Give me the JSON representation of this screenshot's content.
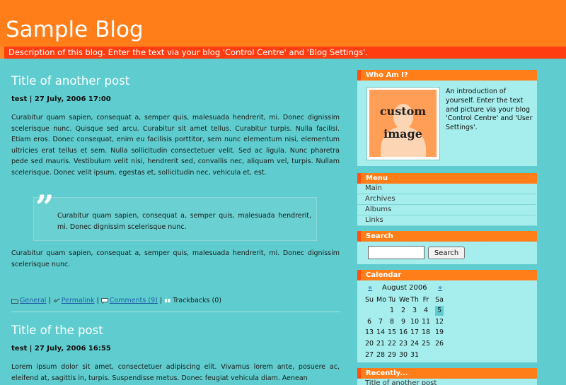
{
  "blog": {
    "title": "Sample Blog",
    "description": "Description of this blog. Enter the text via your blog 'Control Centre' and 'Blog Settings'."
  },
  "posts": [
    {
      "title": "Title of another post",
      "meta": "test | 27 July, 2006 17:00",
      "paragraph1": "Curabitur quam sapien, consequat a, semper quis, malesuada hendrerit, mi. Donec dignissim scelerisque nunc. Quisque sed arcu. Curabitur sit amet tellus. Curabitur turpis. Nulla facilisi. Etiam eros. Donec consequat, enim eu facilisis porttitor, sem nunc elementum nisi, elementum ultricies erat tellus et sem. Nulla sollicitudin consectetuer velit. Sed ac ligula. Nunc pharetra pede sed mauris. Vestibulum velit nisi, hendrerit sed, convallis nec, aliquam vel, turpis. Nullam scelerisque. Donec velit ipsum, egestas et, sollicitudin nec, vehicula et, est.",
      "quote": "Curabitur quam sapien, consequat a, semper quis, malesuada hendrerit, mi. Donec dignissim scelerisque nunc.",
      "paragraph2": "Curabitur quam sapien, consequat a, semper quis, malesuada hendrerit, mi. Donec dignissim scelerisque nunc.",
      "footer": {
        "category": "General",
        "sep": "|",
        "permalink": "Permalink",
        "comments": "Comments (9)",
        "trackbacks": "Trackbacks (0)"
      }
    },
    {
      "title": "Title of the post",
      "meta": "test | 27 July, 2006 16:55",
      "paragraph1": "Lorem ipsum dolor sit amet, consectetuer adipiscing elit. Vivamus lorem ante, posuere ac, eleifend at, sagittis in, turpis. Suspendisse metus. Donec feugiat vehicula diam. Aenean"
    }
  ],
  "sidebar": {
    "about": {
      "heading": "Who Am I?",
      "image_line1": "custom",
      "image_line2": "image",
      "text": "An introduction of yourself. Enter the text and picture via your blog 'Control Centre' and 'User Settings'."
    },
    "menu": {
      "heading": "Menu",
      "items": [
        "Main",
        "Archives",
        "Albums",
        "Links"
      ]
    },
    "search": {
      "heading": "Search",
      "input_value": "",
      "button_label": "Search"
    },
    "calendar": {
      "heading": "Calendar",
      "prev": "«",
      "next": "»",
      "month": "August 2006",
      "weekdays": [
        "Su",
        "Mo",
        "Tu",
        "We",
        "Th",
        "Fr",
        "Sa"
      ],
      "weeks": [
        [
          "",
          "",
          "1",
          "2",
          "3",
          "4",
          "5"
        ],
        [
          "6",
          "7",
          "8",
          "9",
          "10",
          "11",
          "12"
        ],
        [
          "13",
          "14",
          "15",
          "16",
          "17",
          "18",
          "19"
        ],
        [
          "20",
          "21",
          "22",
          "23",
          "24",
          "25",
          "26"
        ],
        [
          "27",
          "28",
          "29",
          "30",
          "31",
          "",
          ""
        ]
      ],
      "highlighted_day": "5"
    },
    "recent": {
      "heading": "Recently...",
      "items": [
        "Title of another post"
      ]
    }
  },
  "colors": {
    "page_bg": "#5fcdcf",
    "header_orange": "#ff7e1a",
    "desc_bar_red": "#ff3d10",
    "widget_bg": "#a6eded",
    "link_blue": "#1f5fa8"
  }
}
